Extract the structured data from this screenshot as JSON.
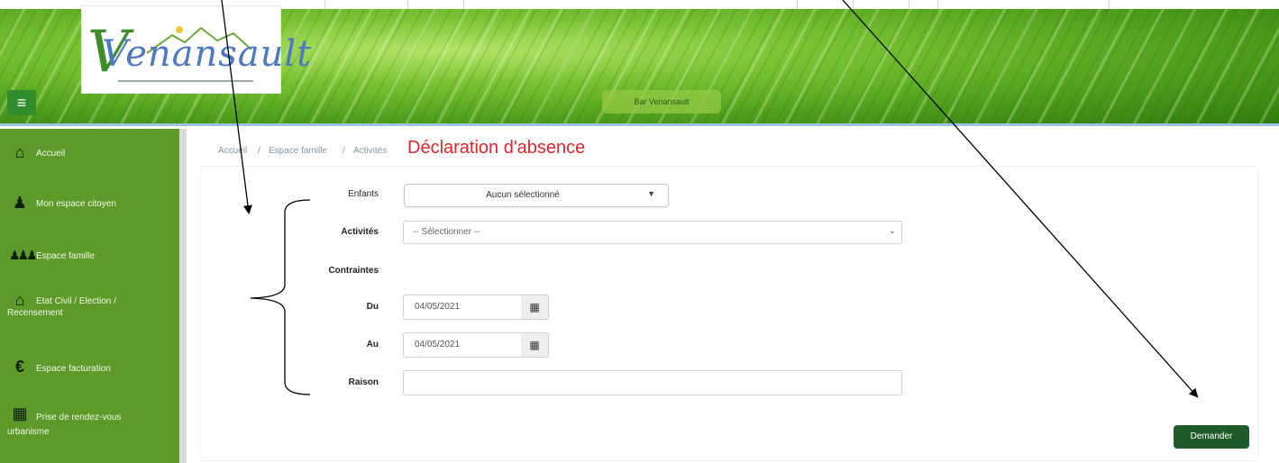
{
  "header": {
    "logo_text": "Venansault",
    "menu_icon": "hamburger-icon",
    "banner_pill": "Bar Venansault"
  },
  "sidebar": {
    "items": [
      {
        "label": "Accueil",
        "icon": "home-icon"
      },
      {
        "label": "Mon espace citoyen",
        "icon": "person-icon"
      },
      {
        "label": "Espace famille",
        "icon": "family-icon"
      },
      {
        "label": "Etat Civil / Election /",
        "label2": "Recensement",
        "icon": "town-hall-icon"
      },
      {
        "label": "Espace facturation",
        "icon": "euro-icon"
      },
      {
        "label": "Prise de rendez-vous",
        "label2": "urbanisme",
        "icon": "calendar-icon"
      }
    ]
  },
  "breadcrumb": {
    "items": [
      "Accueil",
      "Espace famille",
      "Activités"
    ],
    "separator": "/"
  },
  "page_title": "Déclaration d'absence",
  "form": {
    "enfants_label": "Enfants",
    "enfants_value": "Aucun sélectionné",
    "activites_label": "Activités",
    "activites_value": "-- Sélectionner --",
    "contraintes_label": "Contraintes",
    "du_label": "Du",
    "du_value": "04/05/2021",
    "au_label": "Au",
    "au_value": "04/05/2021",
    "raison_label": "Raison",
    "raison_value": "",
    "submit_label": "Demander"
  },
  "colors": {
    "sidebar_bg": "#5e9a2a",
    "title_red": "#e0252b",
    "button_green": "#1f5c2b"
  }
}
